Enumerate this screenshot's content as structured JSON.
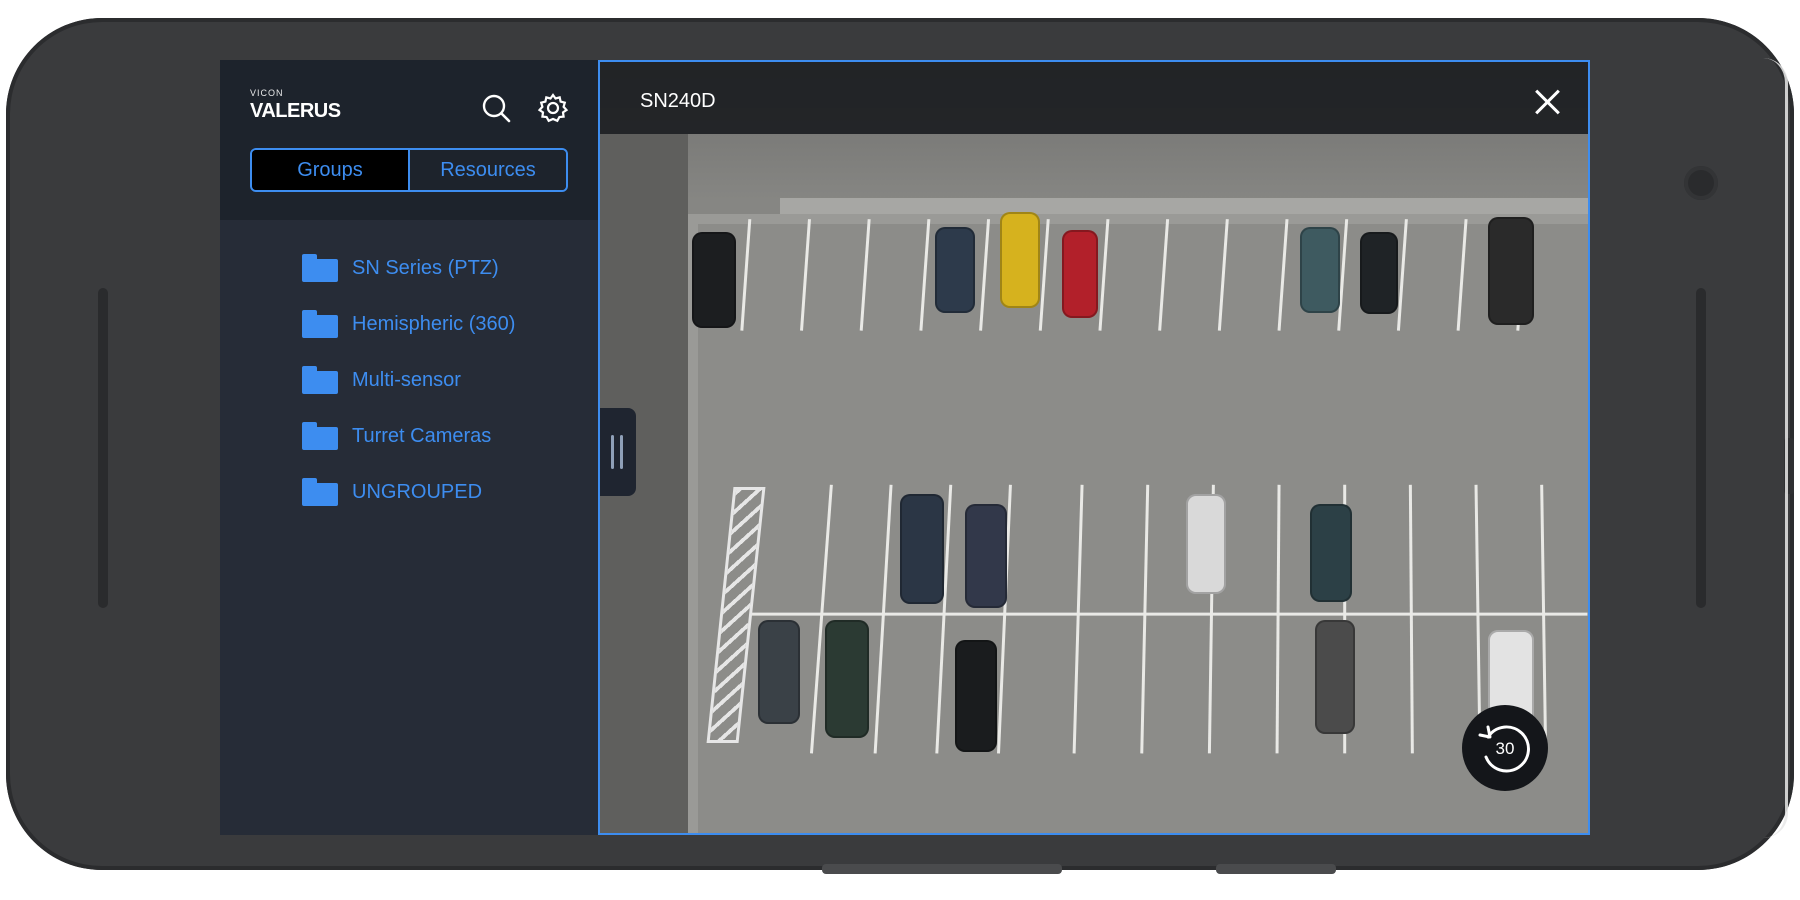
{
  "brand": {
    "small": "VICON",
    "name": "VALERUS"
  },
  "tabs": {
    "groups": "Groups",
    "resources": "Resources"
  },
  "groups": [
    {
      "label": "SN Series (PTZ)"
    },
    {
      "label": "Hemispheric (360)"
    },
    {
      "label": "Multi-sensor"
    },
    {
      "label": "Turret Cameras"
    },
    {
      "label": "UNGROUPED"
    }
  ],
  "video": {
    "camera_name": "SN240D",
    "replay_seconds": "30"
  },
  "colors": {
    "accent": "#3d8df0",
    "sidebar": "#262c37",
    "header": "#1d232c"
  },
  "icons": {
    "search": "search-icon",
    "settings": "settings-icon",
    "close": "close-icon",
    "folder": "folder-icon",
    "replay": "replay-icon"
  }
}
